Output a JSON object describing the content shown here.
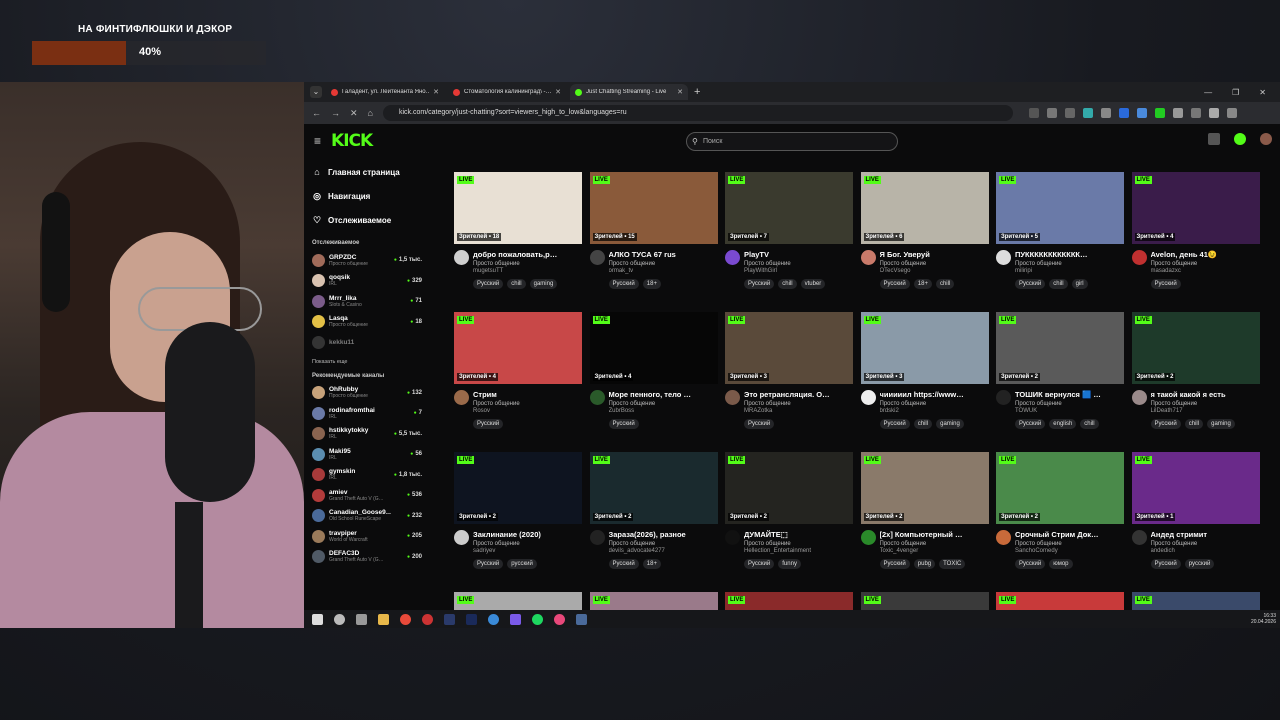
{
  "overlay": {
    "goal_title": "НА ФИНТИФЛЮШКИ И ДЭКОР",
    "goal_percent": "40%",
    "goal_progress": 0.4
  },
  "browser": {
    "tabs": [
      {
        "label": "Галадент, ул. Лейтенанта Яно…",
        "favicon_color": "#e53935"
      },
      {
        "label": "Стоматология калининград\\ -…",
        "favicon_color": "#e53935"
      },
      {
        "label": "Just Chatting Streaming - Live",
        "favicon_color": "#53fc18",
        "active": true
      }
    ],
    "url": "kick.com/category/just-chatting?sort=viewers_high_to_low&languages=ru"
  },
  "kick": {
    "logo": "KICK",
    "search_placeholder": "Поиск",
    "nav": [
      {
        "icon": "home-icon",
        "glyph": "⌂",
        "label": "Главная страница"
      },
      {
        "icon": "compass-icon",
        "glyph": "◎",
        "label": "Навигация"
      },
      {
        "icon": "heart-icon",
        "glyph": "♡",
        "label": "Отслеживаемое"
      }
    ],
    "followed_title": "Отслеживаемое",
    "followed": [
      {
        "name": "GRPZDC",
        "category": "Просто общение",
        "viewers": "1,5 тыс.",
        "color": "#a06b5a"
      },
      {
        "name": "qoqsik",
        "category": "IRL",
        "viewers": "329",
        "color": "#d9c2b0"
      },
      {
        "name": "Mrrr_lika",
        "category": "Slots & Casino",
        "viewers": "71",
        "color": "#7b5c8a"
      },
      {
        "name": "Lasqa",
        "category": "Просто общение",
        "viewers": "18",
        "color": "#e3c046"
      },
      {
        "name": "kekku11",
        "category": "",
        "viewers": "",
        "color": "#666666"
      }
    ],
    "show_more": "Показать еще",
    "recommended_title": "Рекомендуемые каналы",
    "recommended": [
      {
        "name": "OhRubby",
        "category": "Просто общение",
        "viewers": "132",
        "color": "#c7a27a"
      },
      {
        "name": "rodinafromthai",
        "category": "IRL",
        "viewers": "7",
        "color": "#6a7aa8"
      },
      {
        "name": "hstikkytokky",
        "category": "IRL",
        "viewers": "5,5 тыс.",
        "color": "#8a6450"
      },
      {
        "name": "Maki95",
        "category": "IRL",
        "viewers": "56",
        "color": "#5b8db0"
      },
      {
        "name": "gymskin",
        "category": "IRL",
        "viewers": "1,8 тыс.",
        "color": "#a83a3a"
      },
      {
        "name": "amiev",
        "category": "Grand Theft Auto V (G…",
        "viewers": "536",
        "color": "#b23b3b"
      },
      {
        "name": "Canadian_Goose9…",
        "category": "Old School RuneScape",
        "viewers": "232",
        "color": "#4a6a9a"
      },
      {
        "name": "travpiper",
        "category": "World of Warcraft",
        "viewers": "205",
        "color": "#9a7a5a"
      },
      {
        "name": "DEFAC3D",
        "category": "Grand Theft Auto V (G…",
        "viewers": "200",
        "color": "#505a66"
      }
    ],
    "streams": [
      {
        "title": "добро пожаловать,р…",
        "category": "Просто общение",
        "channel": "mugetsuTT",
        "viewers": "Зрителей • 18",
        "tags": [
          "Русский",
          "chill",
          "gaming"
        ],
        "thumb": "#e8e0d4",
        "avatar": "#cfcfcf"
      },
      {
        "title": "АЛКО ТУСА 67 rus",
        "category": "Просто общение",
        "channel": "ormak_tv",
        "viewers": "Зрителей • 15",
        "tags": [
          "Русский",
          "18+"
        ],
        "thumb": "#8a5a3a",
        "avatar": "#444444"
      },
      {
        "title": "PlayTV",
        "category": "Просто общение",
        "channel": "PlayWithGirl",
        "viewers": "Зрителей • 7",
        "tags": [
          "Русский",
          "chill",
          "vtuber"
        ],
        "thumb": "#3a3a2e",
        "avatar": "#7a4ad0"
      },
      {
        "title": "Я Бог. Уверуй",
        "category": "Просто общение",
        "channel": "OTecVsego",
        "viewers": "Зрителей • 6",
        "tags": [
          "Русский",
          "18+",
          "chill"
        ],
        "thumb": "#b8b4a8",
        "avatar": "#c97a6a"
      },
      {
        "title": "ПУКККККККККККК…",
        "category": "Просто общение",
        "channel": "miliripi",
        "viewers": "Зрителей • 5",
        "tags": [
          "Русский",
          "chill",
          "girl"
        ],
        "thumb": "#6a7aa8",
        "avatar": "#dddddd"
      },
      {
        "title": "Avelon, день 41😉",
        "category": "Просто общение",
        "channel": "masadazxc",
        "viewers": "Зрителей • 4",
        "tags": [
          "Русский"
        ],
        "thumb": "#3a1c4a",
        "avatar": "#c03030"
      },
      {
        "title": "Стрим",
        "category": "Просто общение",
        "channel": "Rosov",
        "viewers": "Зрителей • 4",
        "tags": [
          "Русский"
        ],
        "thumb": "#c84848",
        "avatar": "#9a6a4a"
      },
      {
        "title": "Море пенного, тело …",
        "category": "Просто общение",
        "channel": "ZubrBoss",
        "viewers": "Зрителей • 4",
        "tags": [
          "Русский"
        ],
        "thumb": "#060606",
        "avatar": "#2a5a2a"
      },
      {
        "title": "Это ретрансляция. О…",
        "category": "Просто общение",
        "channel": "MRAZotka",
        "viewers": "Зрителей • 3",
        "tags": [
          "Русский"
        ],
        "thumb": "#5a4a3a",
        "avatar": "#7a5a4a"
      },
      {
        "title": "чииииил https://www…",
        "category": "Просто общение",
        "channel": "brdski2",
        "viewers": "Зрителей • 3",
        "tags": [
          "Русский",
          "chill",
          "gaming"
        ],
        "thumb": "#8a9aa8",
        "avatar": "#eeeeee"
      },
      {
        "title": "ТОШИК вернулся 🟦 …",
        "category": "Просто общение",
        "channel": "TOWUK",
        "viewers": "Зрителей • 2",
        "tags": [
          "Русский",
          "english",
          "chill"
        ],
        "thumb": "#5a5a5a",
        "avatar": "#222222"
      },
      {
        "title": "я такой какой я есть",
        "category": "Просто общение",
        "channel": "LilDeath717",
        "viewers": "Зрителей • 2",
        "tags": [
          "Русский",
          "chill",
          "gaming"
        ],
        "thumb": "#1e3a2a",
        "avatar": "#9a8a8a"
      },
      {
        "title": "Заклинание (2020)",
        "category": "Просто общение",
        "channel": "sadriyev",
        "viewers": "Зрителей • 2",
        "tags": [
          "Русский",
          "русский"
        ],
        "thumb": "#0e1420",
        "avatar": "#cccccc"
      },
      {
        "title": "Зараза(2026), разное",
        "category": "Просто общение",
        "channel": "devils_advocate4277",
        "viewers": "Зрителей • 2",
        "tags": [
          "Русский",
          "18+"
        ],
        "thumb": "#1a2a2e",
        "avatar": "#222222"
      },
      {
        "title": "ДУМАЙТЕ⬚",
        "category": "Просто общение",
        "channel": "Hellection_Entertainment",
        "viewers": "Зрителей • 2",
        "tags": [
          "Русский",
          "funny"
        ],
        "thumb": "#242420",
        "avatar": "#111111"
      },
      {
        "title": "[2x] Компьютерный …",
        "category": "Просто общение",
        "channel": "Toxic_4venger",
        "viewers": "Зрителей • 2",
        "tags": [
          "Русский",
          "pubg",
          "TOXIC"
        ],
        "thumb": "#8a7a6a",
        "avatar": "#2a8a2a"
      },
      {
        "title": "Срочный Стрим Док…",
        "category": "Просто общение",
        "channel": "SanchoComedy",
        "viewers": "Зрителей • 2",
        "tags": [
          "Русский",
          "юмор"
        ],
        "thumb": "#4a8a4a",
        "avatar": "#c86a3a"
      },
      {
        "title": "Андед стримит",
        "category": "Просто общение",
        "channel": "andedich",
        "viewers": "Зрителей • 1",
        "tags": [
          "Русский",
          "русский"
        ],
        "thumb": "#6a2a8a",
        "avatar": "#333333"
      }
    ]
  },
  "taskbar": {
    "time": "16:33",
    "date": "20.04.2026"
  },
  "colors": {
    "accent": "#53fc18",
    "background": "#0b0b0c"
  }
}
